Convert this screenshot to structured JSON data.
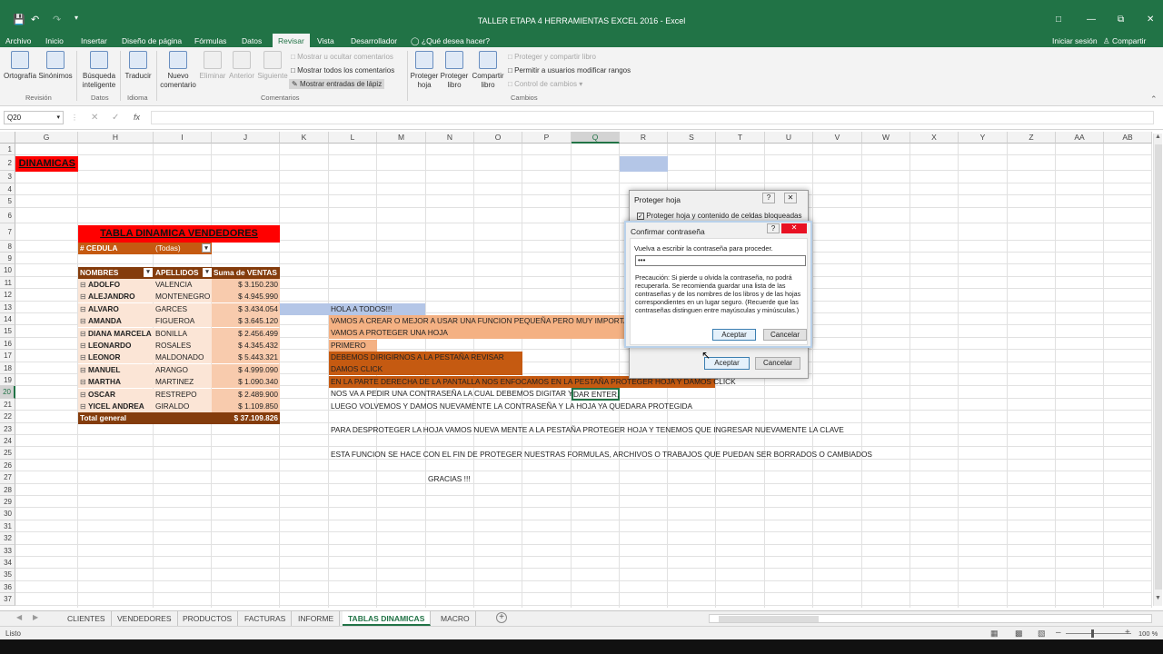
{
  "window": {
    "title": "TALLER ETAPA 4 HERRAMIENTAS EXCEL 2016 - Excel"
  },
  "tabs": [
    "Archivo",
    "Inicio",
    "Insertar",
    "Diseño de página",
    "Fórmulas",
    "Datos",
    "Revisar",
    "Vista",
    "Desarrollador"
  ],
  "tell_me": "¿Qué desea hacer?",
  "signin": "Iniciar sesión",
  "share": "Compartir",
  "ribbon": {
    "ortografia": "Ortografía",
    "sinonimos": "Sinónimos",
    "busqueda1": "Búsqueda",
    "busqueda2": "inteligente",
    "traducir": "Traducir",
    "nuevo1": "Nuevo",
    "nuevo2": "comentario",
    "eliminar": "Eliminar",
    "anterior": "Anterior",
    "siguiente": "Siguiente",
    "mostrar_ocultar": "Mostrar u ocultar comentarios",
    "mostrar_todos": "Mostrar todos los comentarios",
    "mostrar_lapiz": "Mostrar entradas de lápiz",
    "proteger_hoja1": "Proteger",
    "proteger_hoja2": "hoja",
    "proteger_libro1": "Proteger",
    "proteger_libro2": "libro",
    "compartir_libro1": "Compartir",
    "compartir_libro2": "libro",
    "proteger_compartir": "Proteger y compartir libro",
    "permitir": "Permitir a usuarios modificar rangos",
    "control": "Control de cambios",
    "g_revision": "Revisión",
    "g_datos": "Datos",
    "g_idioma": "Idioma",
    "g_comentarios": "Comentarios",
    "g_cambios": "Cambios"
  },
  "namebox": "Q20",
  "fx": "fx",
  "columns": [
    "G",
    "H",
    "I",
    "J",
    "K",
    "L",
    "M",
    "N",
    "O",
    "P",
    "Q",
    "R",
    "S",
    "T",
    "U",
    "V",
    "W",
    "X",
    "Y",
    "Z",
    "AA",
    "AB"
  ],
  "rows": [
    "1",
    "2",
    "3",
    "4",
    "5",
    "6",
    "7",
    "8",
    "9",
    "10",
    "11",
    "12",
    "13",
    "14",
    "15",
    "16",
    "17",
    "18",
    "19",
    "20",
    "21",
    "22",
    "23",
    "24",
    "25",
    "26",
    "27",
    "28",
    "29",
    "30",
    "31",
    "32",
    "33",
    "34",
    "35",
    "36",
    "37"
  ],
  "cells": {
    "dinamicas": "DINAMICAS",
    "pivot_title": "TABLA DINAMICA VENDEDORES",
    "cedula_label": "# CEDULA",
    "cedula_value": "(Todas)",
    "h_nombres": "NOMBRES",
    "h_apellidos": "APELLIDOS",
    "h_suma": "Suma de VENTAS",
    "total_label": "Total general",
    "total_value": "$ 37.109.826"
  },
  "sales": [
    {
      "n": "ADOLFO",
      "a": "VALENCIA",
      "v": "$ 3.150.230"
    },
    {
      "n": "ALEJANDRO",
      "a": "MONTENEGRO",
      "v": "$ 4.945.990"
    },
    {
      "n": "ALVARO",
      "a": "GARCES",
      "v": "$ 3.434.054"
    },
    {
      "n": "AMANDA",
      "a": "FIGUEROA",
      "v": "$ 3.645.120"
    },
    {
      "n": "DIANA MARCELA",
      "a": "BONILLA",
      "v": "$ 2.456.499"
    },
    {
      "n": "LEONARDO",
      "a": "ROSALES",
      "v": "$ 4.345.432"
    },
    {
      "n": "LEONOR",
      "a": "MALDONADO",
      "v": "$ 5.443.321"
    },
    {
      "n": "MANUEL",
      "a": "ARANGO",
      "v": "$ 4.999.090"
    },
    {
      "n": "MARTHA",
      "a": "MARTINEZ",
      "v": "$ 1.090.340"
    },
    {
      "n": "OSCAR",
      "a": "RESTREPO",
      "v": "$ 2.489.900"
    },
    {
      "n": "YICEL ANDREA",
      "a": "GIRALDO",
      "v": "$ 1.109.850"
    }
  ],
  "notes": {
    "r13": "HOLA A TODOS!!!",
    "r14": "VAMOS A CREAR O MEJOR A USAR UNA FUNCION PEQUEÑA PERO MUY IMPORTA",
    "r15": "VAMOS A PROTEGER UNA HOJA",
    "r16": "PRIMERO",
    "r17": "DEBEMOS DIRIGIRNOS A LA PESTAÑA REVISAR",
    "r18": "DAMOS CLICK",
    "r19": "EN LA PARTE DERECHA DE LA PANTALLA NOS ENFOCAMOS EN LA PESTAÑA  PROTEGER HOJA Y DAMOS CLICK",
    "r20": "NOS VA A PEDIR UNA CONTRASEÑA LA CUAL DEBEMOS DIGITAR Y",
    "r20b": "DAR ENTER,",
    "r21": "LUEGO VOLVEMOS Y DAMOS NUEVAMENTE LA CONTRASEÑA  Y LA HOJA YA QUEDARA PROTEGIDA",
    "r23": "PARA DESPROTEGER LA HOJA VAMOS NUEVA MENTE A LA PESTAÑA PROTEGER HOJA Y TENEMOS QUE INGRESAR NUEVAMENTE LA CLAVE",
    "r25": "ESTA FUNCION SE HACE CON EL FIN DE PROTEGER NUESTRAS FORMULAS, ARCHIVOS O TRABAJOS QUE PUEDAN SER BORRADOS O CAMBIADOS",
    "r27": "GRACIAS !!!"
  },
  "dlg_back": {
    "title": "Proteger hoja",
    "checkbox": "Proteger hoja y contenido de celdas bloqueadas",
    "ok": "Aceptar",
    "cancel": "Cancelar",
    "help": "?"
  },
  "dlg_front": {
    "title": "Confirmar contraseña",
    "prompt": "Vuelva a escribir la contraseña para proceder.",
    "password": "•••",
    "warning": "Precaución: Si pierde u olvida la contraseña, no podrá recuperarla. Se recomienda guardar una lista de las contraseñas y de los nombres de los libros y de las hojas correspondientes en un lugar seguro. (Recuerde que las contraseñas distinguen entre mayúsculas y minúsculas.)",
    "ok": "Aceptar",
    "cancel": "Cancelar",
    "help": "?"
  },
  "sheets": [
    "CLIENTES",
    "VENDEDORES",
    "PRODUCTOS",
    "FACTURAS",
    "INFORME",
    "TABLAS DINAMICAS",
    "MACRO"
  ],
  "status": {
    "mode": "Listo",
    "zoom": "100 %"
  }
}
